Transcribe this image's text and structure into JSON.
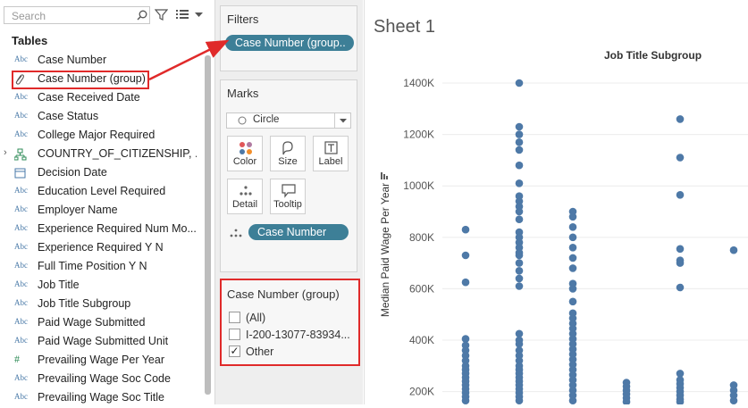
{
  "search": {
    "placeholder": "Search"
  },
  "data_pane": {
    "title": "Tables",
    "fields": [
      {
        "name": "Case Number",
        "icon": "Abc"
      },
      {
        "name": "Case Number (group)",
        "icon": "paperclip"
      },
      {
        "name": "Case Received Date",
        "icon": "Abc"
      },
      {
        "name": "Case Status",
        "icon": "Abc"
      },
      {
        "name": "College Major Required",
        "icon": "Abc"
      },
      {
        "name": "COUNTRY_OF_CITIZENSHIP, ...",
        "icon": "hierarchy"
      },
      {
        "name": "Decision Date",
        "icon": "calendar"
      },
      {
        "name": "Education Level Required",
        "icon": "Abc"
      },
      {
        "name": "Employer Name",
        "icon": "Abc"
      },
      {
        "name": "Experience Required Num Mo...",
        "icon": "Abc"
      },
      {
        "name": "Experience Required Y N",
        "icon": "Abc"
      },
      {
        "name": "Full Time Position Y N",
        "icon": "Abc"
      },
      {
        "name": "Job Title",
        "icon": "Abc"
      },
      {
        "name": "Job Title Subgroup",
        "icon": "Abc"
      },
      {
        "name": "Paid Wage Submitted",
        "icon": "Abc"
      },
      {
        "name": "Paid Wage Submitted Unit",
        "icon": "Abc"
      },
      {
        "name": "Prevailing Wage Per Year",
        "icon": "#"
      },
      {
        "name": "Prevailing Wage Soc Code",
        "icon": "Abc"
      },
      {
        "name": "Prevailing Wage Soc Title",
        "icon": "Abc"
      }
    ]
  },
  "filters": {
    "title": "Filters",
    "pill": "Case Number (group.."
  },
  "marks": {
    "title": "Marks",
    "type": "Circle",
    "buttons": [
      "Color",
      "Size",
      "Label",
      "Detail",
      "Tooltip"
    ],
    "detail_pill": "Case Number"
  },
  "filter_card": {
    "title": "Case Number (group)",
    "options": [
      {
        "label": "(All)",
        "checked": false
      },
      {
        "label": "I-200-13077-83934...",
        "checked": false
      },
      {
        "label": "Other",
        "checked": true
      }
    ]
  },
  "sheet": {
    "title": "Sheet 1"
  },
  "colors": {
    "accent": "#3d7f97",
    "mark": "#4e79a7",
    "highlight": "#e02a2a"
  },
  "chart_data": {
    "type": "scatter",
    "title": "Job Title Subgroup",
    "ylabel": "Median Paid Wage Per Year",
    "ylim": [
      150000,
      1480000
    ],
    "y_ticks": [
      "200K",
      "400K",
      "600K",
      "800K",
      "1000K",
      "1200K",
      "1400K"
    ],
    "y_tick_values": [
      200000,
      400000,
      600000,
      800000,
      1000000,
      1200000,
      1400000
    ],
    "columns": [
      {
        "column": 1,
        "points": [
          830000,
          730000,
          625000,
          405000,
          380000,
          360000,
          340000,
          320000,
          300000,
          285000,
          270000,
          255000,
          240000,
          225000,
          210000,
          195000,
          180000,
          165000
        ]
      },
      {
        "column": 2,
        "points": [
          1400000,
          1230000,
          1200000,
          1170000,
          1140000,
          1080000,
          1010000,
          960000,
          940000,
          920000,
          900000,
          870000,
          820000,
          800000,
          780000,
          760000,
          740000,
          730000,
          700000,
          670000,
          640000,
          610000,
          425000,
          400000,
          385000,
          360000,
          340000,
          320000,
          300000,
          285000,
          270000,
          255000,
          240000,
          225000,
          210000,
          195000,
          180000,
          165000
        ]
      },
      {
        "column": 3,
        "points": [
          900000,
          880000,
          840000,
          800000,
          760000,
          720000,
          680000,
          620000,
          600000,
          550000,
          505000,
          485000,
          465000,
          445000,
          425000,
          405000,
          385000,
          365000,
          345000,
          325000,
          305000,
          285000,
          265000,
          245000,
          225000,
          205000,
          185000,
          165000
        ]
      },
      {
        "column": 4,
        "points": [
          235000,
          220000,
          205000,
          190000,
          175000,
          160000
        ]
      },
      {
        "column": 5,
        "points": [
          1260000,
          1110000,
          965000,
          755000,
          710000,
          700000,
          605000,
          270000,
          245000,
          230000,
          215000,
          200000,
          185000,
          170000,
          160000
        ]
      },
      {
        "column": 6,
        "points": [
          750000,
          225000,
          205000,
          185000,
          165000
        ]
      }
    ]
  }
}
